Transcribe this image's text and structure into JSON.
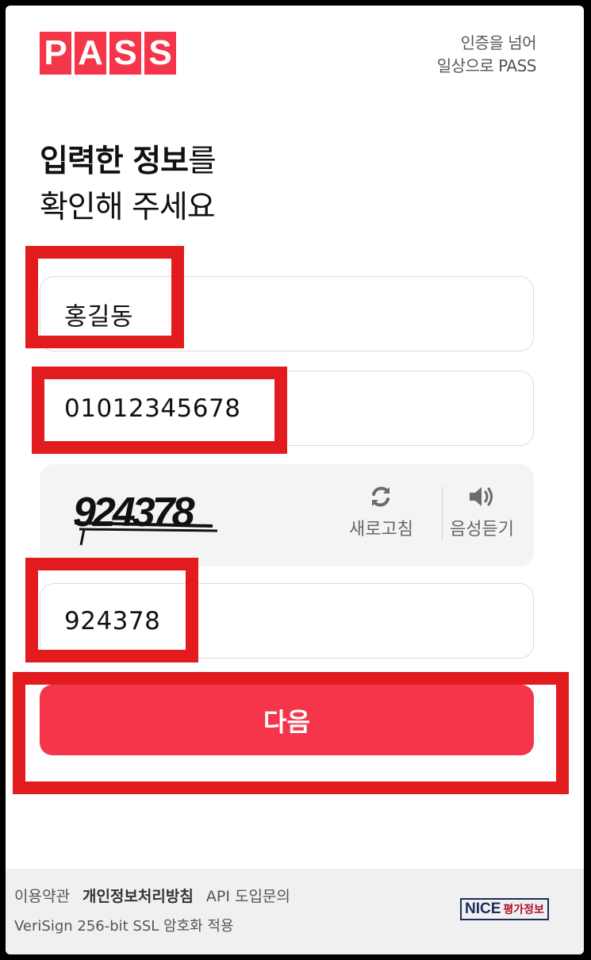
{
  "header": {
    "logo_letters": [
      "P",
      "A",
      "S",
      "S"
    ],
    "tagline_line1": "인증을 넘어",
    "tagline_line2": "일상으로 PASS"
  },
  "title": {
    "bold_part": "입력한 정보",
    "suffix": "를",
    "line2": "확인해 주세요"
  },
  "form": {
    "name_value": "홍길동",
    "phone_value": "01012345678",
    "captcha_code": "924378",
    "refresh_label": "새로고침",
    "audio_label": "음성듣기",
    "captcha_input_value": "924378",
    "next_button": "다음"
  },
  "footer": {
    "terms": "이용약관",
    "privacy": "개인정보처리방침",
    "api": "API 도입문의",
    "ssl": "VeriSign 256-bit SSL 암호화 적용",
    "nice_brand": "NICE",
    "nice_sub": "평가정보"
  },
  "colors": {
    "brand": "#f5364a",
    "highlight": "#e21b1f"
  }
}
